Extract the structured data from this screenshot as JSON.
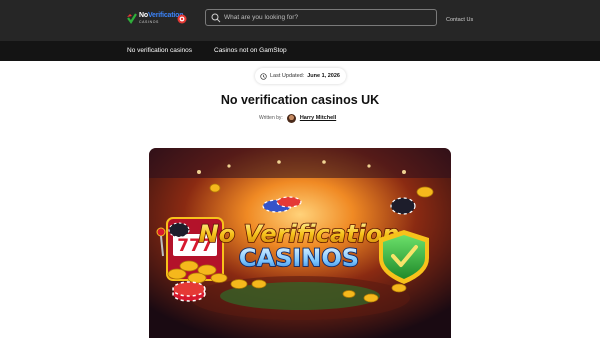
{
  "header": {
    "logo": {
      "brand_prefix": "No",
      "brand_accent": "Verification",
      "tagline": "CASINOS"
    },
    "search": {
      "placeholder": "What are you looking for?"
    },
    "contact_label": "Contact Us"
  },
  "nav": {
    "items": [
      {
        "label": "No verification casinos"
      },
      {
        "label": "Casinos not on GamStop"
      }
    ]
  },
  "article": {
    "last_updated_label": "Last Updated:",
    "last_updated_date": "June 1, 2026",
    "title": "No verification casinos UK",
    "written_by_label": "Written by:",
    "author": "Harry Mitchell"
  },
  "hero": {
    "headline_line1": "No Verification",
    "headline_line2": "CASINOS",
    "reels": "777"
  },
  "colors": {
    "header_bg": "#262626",
    "nav_bg": "#141414",
    "accent_blue": "#3b82f6",
    "headline_gold": "#f7c21b",
    "shield_green": "#2fae3a"
  }
}
